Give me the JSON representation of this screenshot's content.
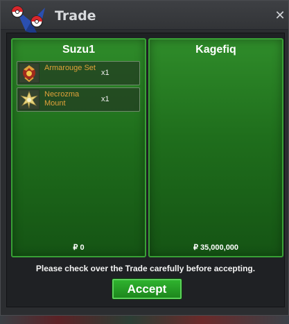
{
  "window": {
    "title": "Trade"
  },
  "left": {
    "player": "Suzu1",
    "items": [
      {
        "name": "Armarouge Set",
        "qty": "x1",
        "icon": "armarouge-set-icon"
      },
      {
        "name": "Necrozma Mount",
        "qty": "x1",
        "icon": "necrozma-mount-icon"
      }
    ],
    "money": "₽ 0"
  },
  "right": {
    "player": "Kagefiq",
    "items": [],
    "money": "₽ 35,000,000"
  },
  "notice": "Please check over the Trade carefully before accepting.",
  "accept_label": "Accept",
  "colors": {
    "panel": "#1f6e1c",
    "panel_border": "#38a135",
    "item_text": "#e0a23a",
    "button": "#2fb22e"
  }
}
